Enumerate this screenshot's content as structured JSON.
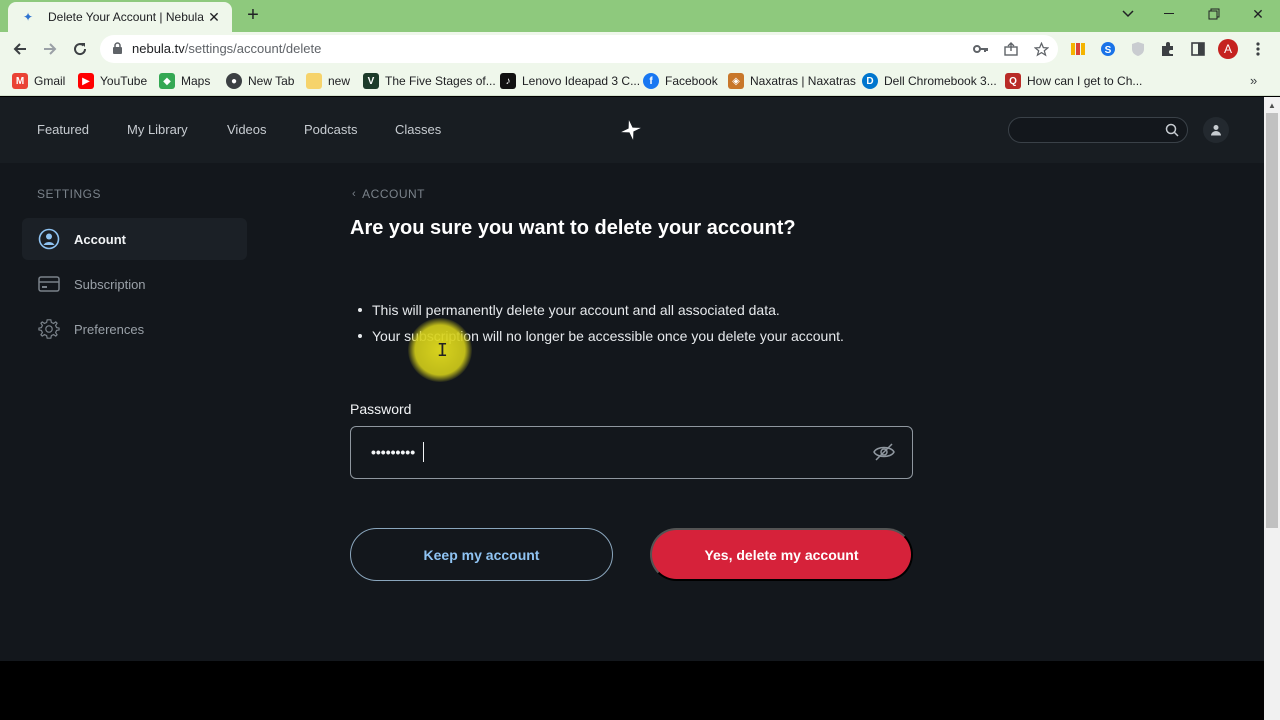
{
  "browser": {
    "tab_title": "Delete Your Account | Nebula",
    "url_host": "nebula.tv",
    "url_path": "/settings/account/delete",
    "profile_initial": "A",
    "bookmarks": [
      {
        "label": "Gmail",
        "icon": "gmail-icon",
        "color": "#ea4335"
      },
      {
        "label": "YouTube",
        "icon": "youtube-icon",
        "color": "#ff0000"
      },
      {
        "label": "Maps",
        "icon": "maps-icon",
        "color": "#34a853"
      },
      {
        "label": "New Tab",
        "icon": "globe-icon",
        "color": "#3c4043"
      },
      {
        "label": "new",
        "icon": "folder-icon",
        "color": "#f6d36b"
      },
      {
        "label": "The Five Stages of...",
        "icon": "v-icon",
        "color": "#1d3b2a"
      },
      {
        "label": "Lenovo Ideapad 3 C...",
        "icon": "tiktok-icon",
        "color": "#111111"
      },
      {
        "label": "Facebook",
        "icon": "facebook-icon",
        "color": "#1877f2"
      },
      {
        "label": "Naxatras | Naxatras",
        "icon": "bandcamp-icon",
        "color": "#c8772a"
      },
      {
        "label": "Dell Chromebook 3...",
        "icon": "dell-icon",
        "color": "#0076ce"
      },
      {
        "label": "How can I get to Ch...",
        "icon": "quora-icon",
        "color": "#b92b27"
      }
    ]
  },
  "site": {
    "nav": [
      "Featured",
      "My Library",
      "Videos",
      "Podcasts",
      "Classes"
    ]
  },
  "sidebar": {
    "section_label": "SETTINGS",
    "items": [
      {
        "label": "Account",
        "icon": "user-circle-icon",
        "active": true
      },
      {
        "label": "Subscription",
        "icon": "card-icon",
        "active": false
      },
      {
        "label": "Preferences",
        "icon": "gear-icon",
        "active": false
      }
    ]
  },
  "main": {
    "breadcrumb": "ACCOUNT",
    "heading": "Are you sure you want to delete your account?",
    "bullets": [
      "This will permanently delete your account and all associated data.",
      "Your subscription will no longer be accessible once you delete your account."
    ],
    "password_label": "Password",
    "password_value": "•••••••••",
    "keep_button": "Keep my account",
    "delete_button": "Yes, delete my account"
  },
  "colors": {
    "page_bg": "#13171c",
    "delete_red": "#d6223a",
    "keep_blue": "#8fc3f2",
    "chrome_green": "#8ec97d"
  }
}
